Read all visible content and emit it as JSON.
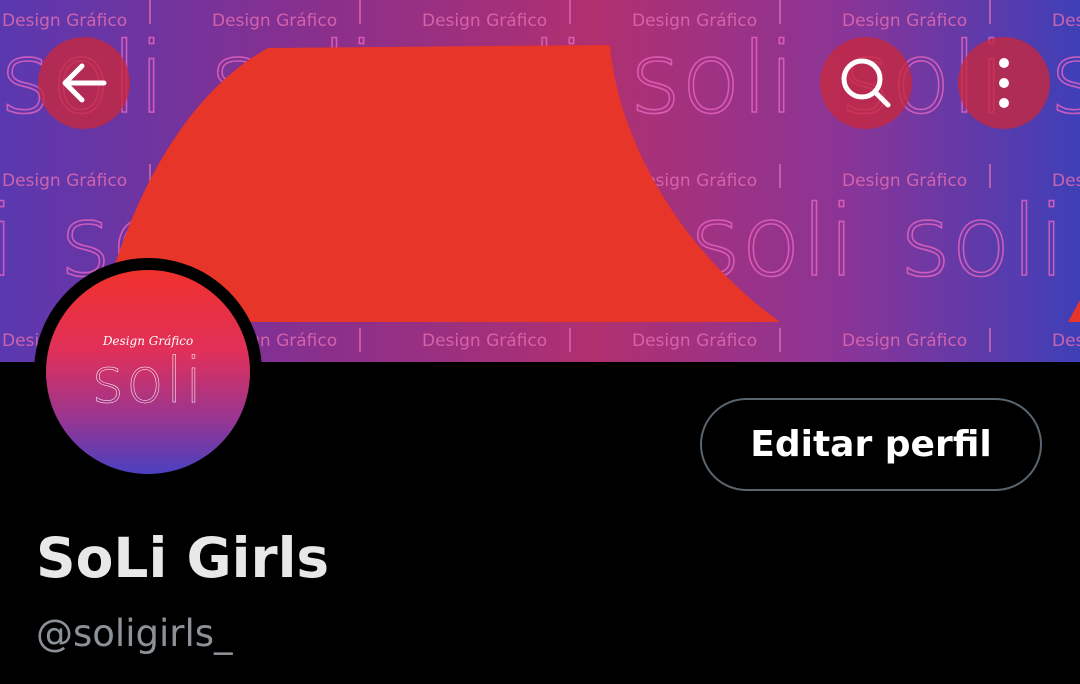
{
  "banner": {
    "pattern_small": "Design Gráfico",
    "pattern_large": "soli",
    "colors": {
      "purple": "#5a38b0",
      "magenta": "#b03070",
      "blue": "#3f3fb8",
      "red_shape": "#e8352a"
    }
  },
  "toolbar": {
    "back_icon": "arrow-left-icon",
    "search_icon": "search-icon",
    "more_icon": "more-vertical-icon"
  },
  "avatar": {
    "small_text": "Design Gráfico",
    "wordmark": "soli"
  },
  "profile": {
    "edit_button_label": "Editar perfil",
    "display_name": "SoLi Girls",
    "handle": "@soligirls_"
  }
}
